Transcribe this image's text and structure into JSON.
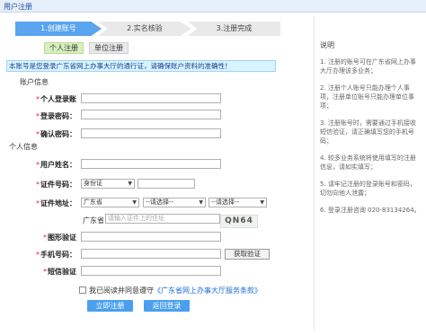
{
  "window": {
    "title": "用户注册"
  },
  "steps": [
    {
      "label": "1.创建账号"
    },
    {
      "label": "2.实名核验"
    },
    {
      "label": "3.注册完成"
    }
  ],
  "tabs": [
    {
      "label": "个人注册"
    },
    {
      "label": "单位注册"
    }
  ],
  "notice": "本账号是您登录广东省网上办事大厅的通行证，请确保账户资料的准确性！",
  "account_section": "账户信息",
  "personal_section": "个人信息",
  "fields": {
    "username": {
      "label": "个人登录账",
      "value": ""
    },
    "password": {
      "label": "登录密码：",
      "value": ""
    },
    "confirm_password": {
      "label": "确认密码：",
      "value": ""
    },
    "real_name": {
      "label": "用户姓名：",
      "value": ""
    },
    "id_type": {
      "label": "证件号码：",
      "selected": "身份证"
    },
    "id_number": {
      "value": ""
    },
    "address": {
      "label": "证件地址：",
      "province_selected": "广东省",
      "city_selected": "--请选择--",
      "district_selected": "--请选择--",
      "prefix": "广东省",
      "detail_placeholder": "请输入证件上的住址"
    },
    "captcha": {
      "label": "图形验证",
      "code": "QN64"
    },
    "phone": {
      "label": "手机号码：",
      "button": "获取验证"
    },
    "sms_code": {
      "label": "短信验证"
    }
  },
  "agreement": {
    "text": "我已阅读并同意遵守",
    "link": "《广东省网上办事大厅服务条款》"
  },
  "buttons": {
    "register": "立即注册",
    "back": "返回登录"
  },
  "instructions": {
    "title": "说明",
    "items": [
      "1. 注册的账号可在广东省网上办事大厅办理该多业务；",
      "2. 注册个人账号只能办理个人事项，注册单位账号只能办理单位事项；",
      "3. 注册账号时，需要通过手机接收短信验证，请正确填写您的手机号码；",
      "4. 较多业务系统将使用填写的注册信息，请如实填写；",
      "5. 请牢记注册的登录账号和密码，切勿向他人泄露；",
      "6. 登录注册咨询 020-83134264。"
    ]
  },
  "colors": {
    "accent": "#4aa0ef",
    "step_active": "#5aa4f0",
    "required": "#e23",
    "link": "#1a6fd6"
  }
}
